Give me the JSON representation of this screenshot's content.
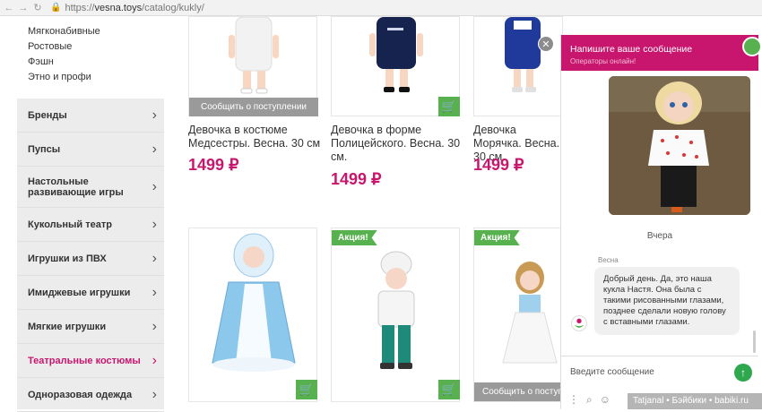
{
  "browser": {
    "back": "←",
    "forward": "→",
    "reload": "↻",
    "url_scheme": "https://",
    "url_host": "vesna.toys",
    "url_path": "/catalog/kukly/"
  },
  "category_links": [
    "Мягконабивные",
    "Ростовые",
    "Фэшн",
    "Этно и профи"
  ],
  "sidebar": {
    "items": [
      {
        "label": "Бренды"
      },
      {
        "label": "Пупсы"
      },
      {
        "label": "Настольные развивающие игры"
      },
      {
        "label": "Кукольный театр"
      },
      {
        "label": "Игрушки из ПВХ"
      },
      {
        "label": "Имиджевые игрушки"
      },
      {
        "label": "Мягкие игрушки"
      },
      {
        "label": "Театральные костюмы"
      },
      {
        "label": "Одноразовая одежда"
      }
    ],
    "active_color": "#c8166e"
  },
  "products_top": [
    {
      "notify": "Сообщить о поступлении",
      "title": "Девочка в костюме Медсестры. Весна. 30 см",
      "price": "1499 ₽"
    },
    {
      "title": "Девочка в форме Полицейского. Весна. 30 см.",
      "price": "1499 ₽"
    },
    {
      "title": "Девочка Морячка. Весна. 30 см",
      "price": "1499 ₽"
    }
  ],
  "products_bottom": [
    {
      "promo": ""
    },
    {
      "promo": "Акция!"
    },
    {
      "promo": "Акция!",
      "notify": "Сообщить о поступлении"
    }
  ],
  "chat": {
    "header_title": "Напишите ваше сообщение",
    "header_subtitle": "Операторы онлайн!",
    "close": "✕",
    "day": "Вчера",
    "author": "Весна",
    "message": "Добрый день. Да, это наша кукла Настя. Она была с такими рисованными глазами, позднее сделали новую голову с вставными глазами.",
    "input_placeholder": "Введите сообщение",
    "send": "↑",
    "tools": [
      "⋮",
      "⌕",
      "☺"
    ]
  },
  "watermark": "Tatjanal • Бэйбики • babiki.ru",
  "colors": {
    "brand": "#c8166e",
    "accent_green": "#58b14f"
  }
}
